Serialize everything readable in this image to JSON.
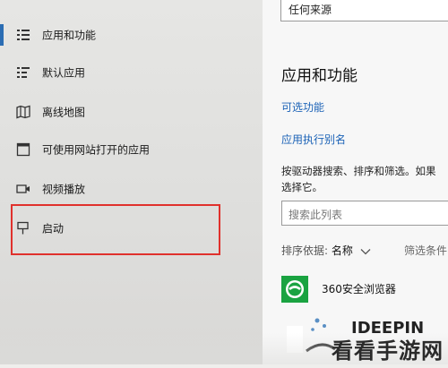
{
  "nav": {
    "items": [
      {
        "label": "应用和功能",
        "icon": "apps-list-icon",
        "selected": true
      },
      {
        "label": "默认应用",
        "icon": "default-apps-icon"
      },
      {
        "label": "离线地图",
        "icon": "offline-map-icon"
      },
      {
        "label": "可使用网站打开的应用",
        "icon": "open-with-website-icon"
      },
      {
        "label": "视频播放",
        "icon": "video-playback-icon"
      },
      {
        "label": "启动",
        "icon": "startup-icon"
      }
    ]
  },
  "right": {
    "install_source_value": "任何来源",
    "section_title": "应用和功能",
    "optional_features_link": "可选功能",
    "app_alias_link": "应用执行别名",
    "description": "按驱动器搜索、排序和筛选。如果\n选择它。",
    "search_placeholder": "搜索此列表",
    "sort_label": "排序依据:",
    "sort_value": "名称",
    "filter_label": "筛选条件",
    "apps": [
      {
        "name": "360安全浏览器",
        "icon": "browser-360-icon"
      }
    ]
  },
  "watermark": {
    "logo_text": "IDEEPIN",
    "site_text": "看看手游网"
  },
  "colors": {
    "accent": "#2b6db3",
    "link": "#1c63b7",
    "highlight": "#e0312c",
    "app_icon_green": "#1aa341"
  }
}
